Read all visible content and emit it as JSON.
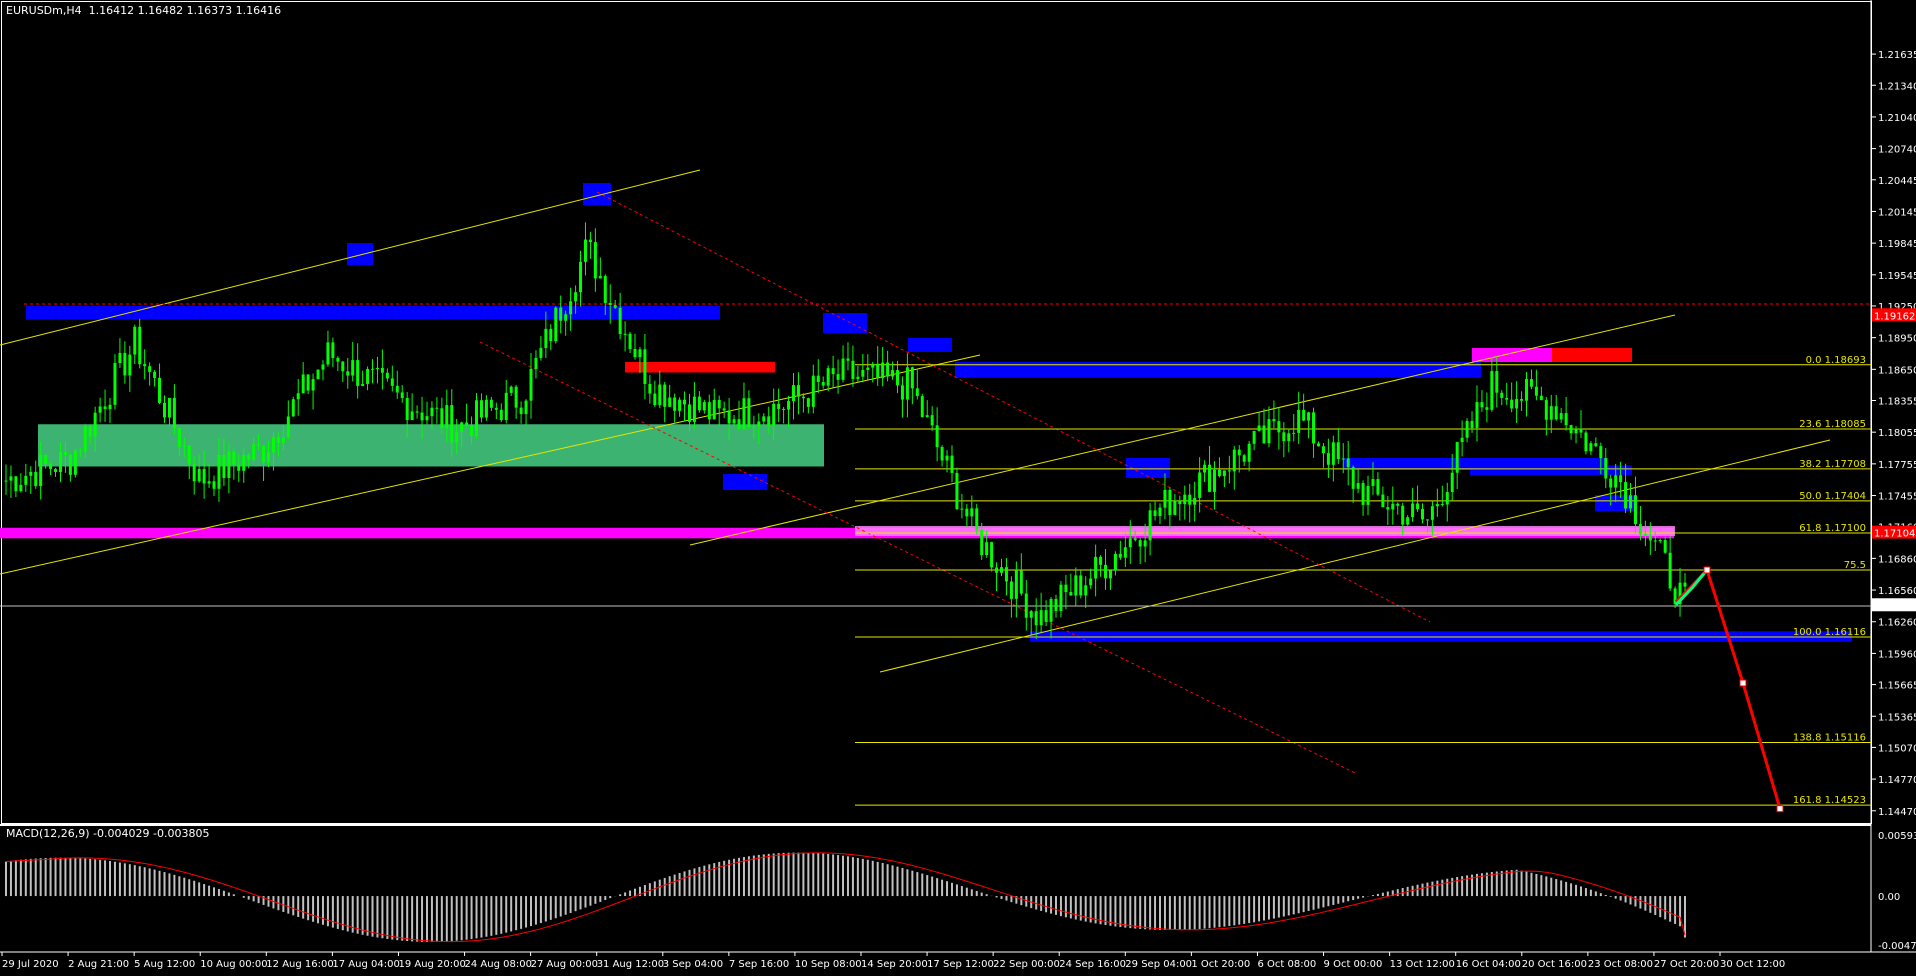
{
  "header": {
    "symbol": "EURUSDm,H4",
    "quote": "1.16412 1.16482 1.16373 1.16416"
  },
  "macd_header": {
    "label": "MACD(12,26,9) -0.004029 -0.003805"
  },
  "colors": {
    "background": "#000000",
    "candle": "#00ff00",
    "axis": "#ffffff",
    "zone_blue": "#0000ff",
    "zone_red": "#ff0000",
    "zone_magenta": "#ff00ff",
    "zone_green": "#3cb371",
    "trendline": "#e6e600",
    "fib": "#e6e600",
    "forecast": "#ff0000",
    "forecast_green": "#00ff7f",
    "macd_hist": "#c0c0c0",
    "macd_signal": "#ff0000"
  },
  "price_axis": {
    "ticks": [
      "1.21635",
      "1.21340",
      "1.21040",
      "1.20740",
      "1.20445",
      "1.20145",
      "1.19845",
      "1.19545",
      "1.19250",
      "1.18950",
      "1.18650",
      "1.18355",
      "1.18055",
      "1.17755",
      "1.17455",
      "1.17160",
      "1.16860",
      "1.16560",
      "1.16260",
      "1.15960",
      "1.15665",
      "1.15365",
      "1.15070",
      "1.14770",
      "1.14470"
    ],
    "ylim": [
      1.1443,
      1.2192
    ],
    "current_price": "1.16416",
    "red_tag_top": "1.19162",
    "red_tag_mid": "1.17104"
  },
  "macd_axis": {
    "ticks": [
      "0.005937",
      "0.00",
      "-0.004758"
    ]
  },
  "time_axis": {
    "labels": [
      "29 Jul 2020",
      "2 Aug 21:00",
      "5 Aug 12:00",
      "10 Aug 00:00",
      "12 Aug 16:00",
      "17 Aug 04:00",
      "19 Aug 20:00",
      "24 Aug 08:00",
      "27 Aug 00:00",
      "31 Aug 12:00",
      "3 Sep 04:00",
      "7 Sep 16:00",
      "10 Sep 08:00",
      "14 Sep 20:00",
      "17 Sep 12:00",
      "22 Sep 00:00",
      "24 Sep 16:00",
      "29 Sep 04:00",
      "1 Oct 20:00",
      "6 Oct 08:00",
      "9 Oct 00:00",
      "13 Oct 12:00",
      "16 Oct 04:00",
      "20 Oct 16:00",
      "23 Oct 08:00",
      "27 Oct 20:00",
      "30 Oct 12:00"
    ]
  },
  "fibonacci": [
    {
      "label": "0.0 1.18693",
      "level": "0.0",
      "price": 1.18693
    },
    {
      "label": "23.6 1.18085",
      "level": "23.6",
      "price": 1.18085
    },
    {
      "label": "38.2 1.17708",
      "level": "38.2",
      "price": 1.17708
    },
    {
      "label": "50.0 1.17404",
      "level": "50.0",
      "price": 1.17404
    },
    {
      "label": "61.8 1.17100",
      "level": "61.8",
      "price": 1.171
    },
    {
      "label": "75.5",
      "level": "75.5",
      "price": 1.1675
    },
    {
      "label": "100.0 1.16116",
      "level": "100.0",
      "price": 1.16116
    },
    {
      "label": "138.8 1.15116",
      "level": "138.8",
      "price": 1.15116
    },
    {
      "label": "161.8 1.14523",
      "level": "161.8",
      "price": 1.14523
    }
  ],
  "chart_data": {
    "type": "candlestick",
    "symbol": "EURUSDm",
    "timeframe": "H4",
    "last": {
      "open": 1.16412,
      "high": 1.16482,
      "low": 1.16373,
      "close": 1.16416
    },
    "ylim": [
      1.1443,
      1.2192
    ],
    "close_path": [
      {
        "t": "29 Jul 2020",
        "price": 1.176
      },
      {
        "t": "2 Aug 21:00",
        "price": 1.178
      },
      {
        "t": "5 Aug 12:00",
        "price": 1.189
      },
      {
        "t": "10 Aug 00:00",
        "price": 1.176
      },
      {
        "t": "12 Aug 16:00",
        "price": 1.179
      },
      {
        "t": "17 Aug 04:00",
        "price": 1.188
      },
      {
        "t": "19 Aug 20:00",
        "price": 1.184
      },
      {
        "t": "24 Aug 08:00",
        "price": 1.181
      },
      {
        "t": "27 Aug 00:00",
        "price": 1.184
      },
      {
        "t": "31 Aug 12:00",
        "price": 1.198
      },
      {
        "t": "3 Sep 04:00",
        "price": 1.185
      },
      {
        "t": "7 Sep 16:00",
        "price": 1.182
      },
      {
        "t": "10 Sep 08:00",
        "price": 1.183
      },
      {
        "t": "14 Sep 20:00",
        "price": 1.186
      },
      {
        "t": "17 Sep 12:00",
        "price": 1.185
      },
      {
        "t": "22 Sep 00:00",
        "price": 1.171
      },
      {
        "t": "24 Sep 16:00",
        "price": 1.163
      },
      {
        "t": "29 Sep 04:00",
        "price": 1.168
      },
      {
        "t": "1 Oct 20:00",
        "price": 1.174
      },
      {
        "t": "6 Oct 08:00",
        "price": 1.178
      },
      {
        "t": "9 Oct 00:00",
        "price": 1.182
      },
      {
        "t": "13 Oct 12:00",
        "price": 1.175
      },
      {
        "t": "16 Oct 04:00",
        "price": 1.172
      },
      {
        "t": "20 Oct 16:00",
        "price": 1.185
      },
      {
        "t": "23 Oct 08:00",
        "price": 1.183
      },
      {
        "t": "27 Oct 20:00",
        "price": 1.176
      },
      {
        "t": "30 Oct 12:00",
        "price": 1.1642
      }
    ],
    "zones": [
      {
        "color": "blue",
        "price_top": 1.1925,
        "price_bottom": 1.1912
      },
      {
        "color": "red",
        "price_top": 1.1872,
        "price_bottom": 1.1862
      },
      {
        "color": "green",
        "price_top": 1.1813,
        "price_bottom": 1.1773
      },
      {
        "color": "magenta",
        "price_top": 1.1715,
        "price_bottom": 1.1705
      },
      {
        "color": "blue",
        "price_top": 1.1872,
        "price_bottom": 1.1857
      },
      {
        "color": "blue",
        "price_top": 1.1774,
        "price_bottom": 1.1765
      },
      {
        "color": "blue",
        "price_top": 1.1617,
        "price_bottom": 1.1607
      }
    ],
    "forecast": [
      {
        "price": 1.1675
      },
      {
        "price": 1.1568
      },
      {
        "price": 1.1449
      }
    ],
    "macd": {
      "params": "12,26,9",
      "main": -0.004029,
      "signal": -0.003805,
      "ylim": [
        -0.004758,
        0.005937
      ]
    }
  }
}
